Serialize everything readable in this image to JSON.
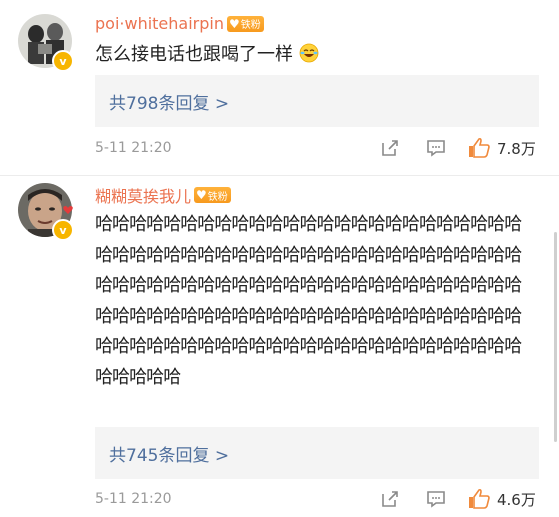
{
  "comments": [
    {
      "username": "poi·whitehairpin",
      "fan_badge": "铁粉",
      "text": "怎么接电话也跟喝了一样",
      "emoji_icon": "laughing-crying-emoji",
      "replies": "共798条回复 >",
      "time": "5-11 21:20",
      "likes": "7.8万"
    },
    {
      "username": "糊糊莫挨我儿",
      "fan_badge": "铁粉",
      "text": "哈哈哈哈哈哈哈哈哈哈哈哈哈哈哈哈哈哈哈哈哈哈哈哈哈哈哈哈哈哈哈哈哈哈哈哈哈哈哈哈哈哈哈哈哈哈哈哈哈哈哈哈哈哈哈哈哈哈哈哈哈哈哈哈哈哈哈哈哈哈哈哈哈哈哈哈哈哈哈哈哈哈哈哈哈哈哈哈哈哈哈哈哈哈哈哈哈哈哈哈哈哈哈哈哈哈哈哈哈哈哈哈哈哈哈哈哈哈哈哈哈哈哈哈哈哈哈哈哈哈",
      "replies": "共745条回复 >",
      "time": "5-11 21:20",
      "likes": "4.6万"
    }
  ],
  "colors": {
    "username": "#eb7350",
    "reply_link": "#4f6f9d",
    "like_icon": "#f08a3c",
    "verified_badge": "#f7b500"
  }
}
